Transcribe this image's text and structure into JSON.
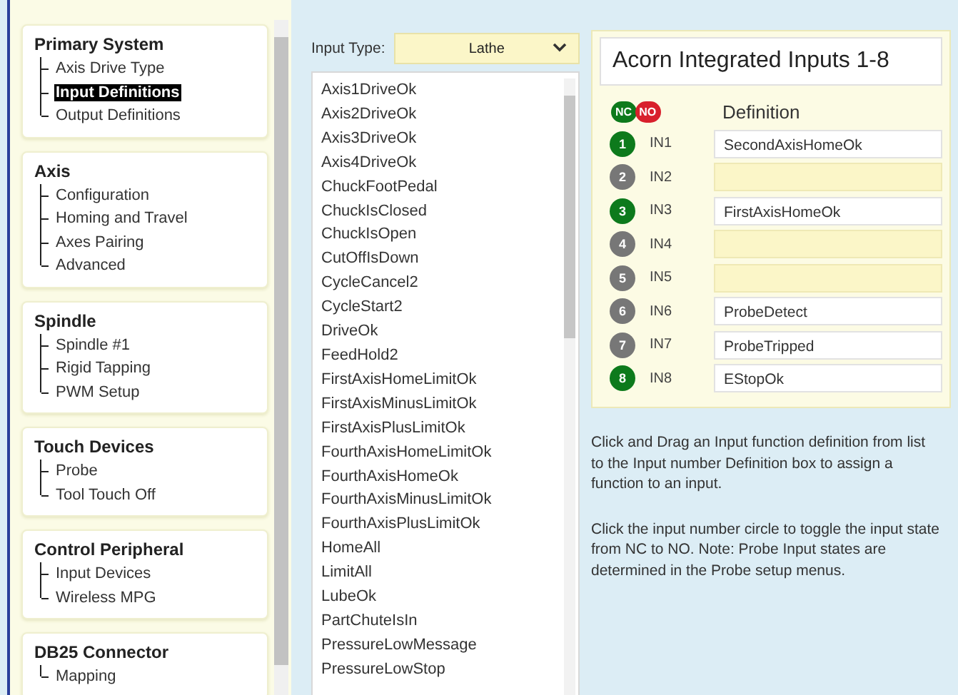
{
  "sidebar": {
    "groups": [
      {
        "title": "Primary System",
        "items": [
          {
            "label": "Axis Drive Type",
            "selected": false
          },
          {
            "label": "Input Definitions",
            "selected": true
          },
          {
            "label": "Output Definitions",
            "selected": false
          }
        ]
      },
      {
        "title": "Axis",
        "items": [
          {
            "label": "Configuration",
            "selected": false
          },
          {
            "label": "Homing and Travel",
            "selected": false
          },
          {
            "label": "Axes Pairing",
            "selected": false
          },
          {
            "label": "Advanced",
            "selected": false
          }
        ]
      },
      {
        "title": "Spindle",
        "items": [
          {
            "label": "Spindle #1",
            "selected": false
          },
          {
            "label": "Rigid Tapping",
            "selected": false
          },
          {
            "label": "PWM Setup",
            "selected": false
          }
        ]
      },
      {
        "title": "Touch Devices",
        "items": [
          {
            "label": "Probe",
            "selected": false
          },
          {
            "label": "Tool Touch Off",
            "selected": false
          }
        ]
      },
      {
        "title": "Control Peripheral",
        "items": [
          {
            "label": "Input Devices",
            "selected": false
          },
          {
            "label": "Wireless MPG",
            "selected": false
          }
        ]
      },
      {
        "title": "DB25 Connector",
        "items": [
          {
            "label": "Mapping",
            "selected": false
          }
        ]
      }
    ]
  },
  "input_type": {
    "label": "Input Type:",
    "value": "Lathe"
  },
  "functions": [
    "Axis1DriveOk",
    "Axis2DriveOk",
    "Axis3DriveOk",
    "Axis4DriveOk",
    "ChuckFootPedal",
    "ChuckIsClosed",
    "ChuckIsOpen",
    "CutOffIsDown",
    "CycleCancel2",
    "CycleStart2",
    "DriveOk",
    "FeedHold2",
    "FirstAxisHomeLimitOk",
    "FirstAxisMinusLimitOk",
    "FirstAxisPlusLimitOk",
    "FourthAxisHomeLimitOk",
    "FourthAxisHomeOk",
    "FourthAxisMinusLimitOk",
    "FourthAxisPlusLimitOk",
    "HomeAll",
    "LimitAll",
    "LubeOk",
    "PartChuteIsIn",
    "PressureLowMessage",
    "PressureLowStop"
  ],
  "inputs_panel": {
    "title": "Acorn Integrated Inputs 1-8",
    "legend": {
      "nc": "NC",
      "no": "NO"
    },
    "definition_heading": "Definition",
    "inputs": [
      {
        "number": "1",
        "name": "IN1",
        "active": true,
        "definition": "SecondAxisHomeOk"
      },
      {
        "number": "2",
        "name": "IN2",
        "active": false
      },
      {
        "number": "3",
        "name": "IN3",
        "active": true,
        "definition": "FirstAxisHomeOk"
      },
      {
        "number": "4",
        "name": "IN4",
        "active": false
      },
      {
        "number": "5",
        "name": "IN5",
        "active": false
      },
      {
        "number": "6",
        "name": "IN6",
        "active": false,
        "definition": "ProbeDetect"
      },
      {
        "number": "7",
        "name": "IN7",
        "active": false,
        "definition": "ProbeTripped"
      },
      {
        "number": "8",
        "name": "IN8",
        "active": true,
        "definition": "EStopOk"
      }
    ]
  },
  "help": [
    "Click and Drag an Input function definition from list to the Input number Definition box to assign a function to an input.",
    "Click the input number circle to toggle the input state from NC to NO. Note: Probe Input states are determined in the Probe setup menus."
  ]
}
